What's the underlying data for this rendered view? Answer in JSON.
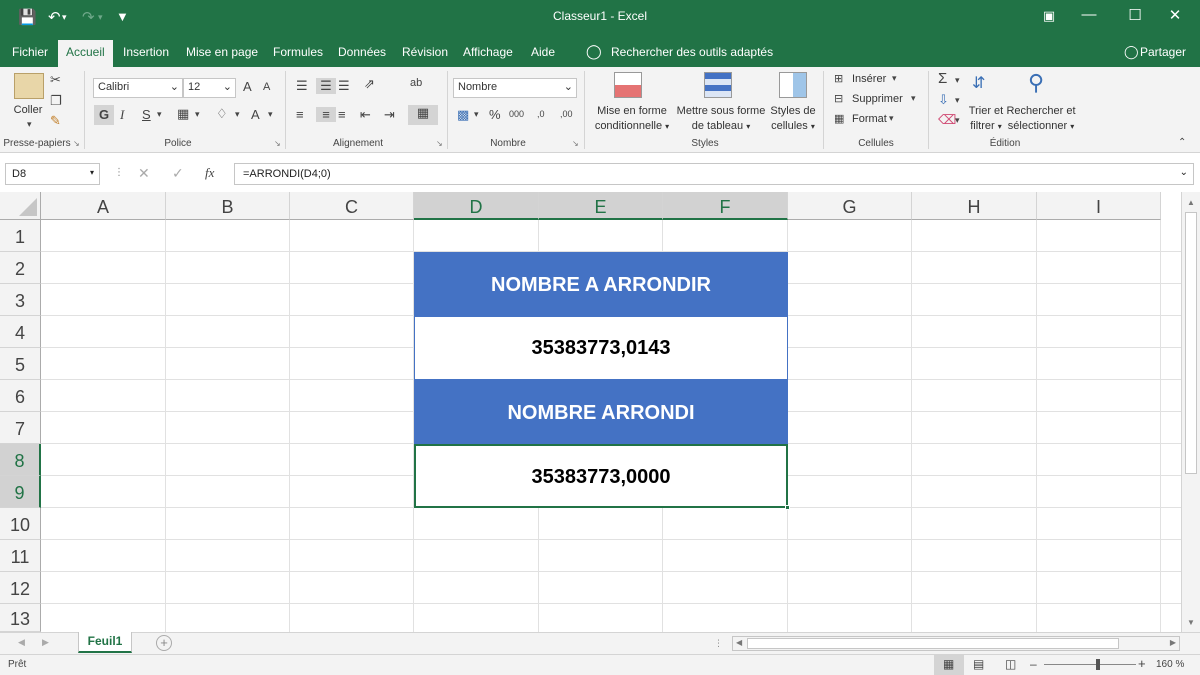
{
  "window": {
    "title": "Classeur1  -  Excel",
    "share_label": "Partager"
  },
  "menu": {
    "tabs": [
      "Fichier",
      "Accueil",
      "Insertion",
      "Mise en page",
      "Formules",
      "Données",
      "Révision",
      "Affichage",
      "Aide"
    ],
    "active_tab": "Accueil",
    "search_hint": "Rechercher des outils adaptés"
  },
  "ribbon": {
    "clipboard": {
      "paste": "Coller",
      "label": "Presse-papiers"
    },
    "font": {
      "name": "Calibri",
      "size": "12",
      "bold": "G",
      "italic": "I",
      "underline": "S",
      "grow": "A",
      "shrink": "A",
      "color_letter": "A",
      "label": "Police"
    },
    "alignment": {
      "label": "Alignement",
      "wrap": "ab"
    },
    "number": {
      "format": "Nombre",
      "percent": "%",
      "thousands": "000",
      "inc_dec": ",0",
      "dec_dec": ",00",
      "label": "Nombre"
    },
    "styles": {
      "conditional": "Mise en forme conditionnelle",
      "table": "Mettre sous forme de tableau",
      "cell_styles": "Styles de cellules",
      "label": "Styles"
    },
    "cells": {
      "insert": "Insérer",
      "delete": "Supprimer",
      "format": "Format",
      "label": "Cellules"
    },
    "editing": {
      "sort": "Trier et filtrer",
      "find": "Rechercher et sélectionner",
      "label": "Édition"
    }
  },
  "formula_bar": {
    "name_box": "D8",
    "formula": "=ARRONDI(D4;0)",
    "fx": "fx"
  },
  "sheet": {
    "columns": [
      "A",
      "B",
      "C",
      "D",
      "E",
      "F",
      "G",
      "H",
      "I"
    ],
    "selected_columns": [
      "D",
      "E",
      "F"
    ],
    "rows": [
      "1",
      "2",
      "3",
      "4",
      "5",
      "6",
      "7",
      "8",
      "9",
      "10",
      "11",
      "12",
      "13"
    ],
    "selected_rows": [
      "8",
      "9"
    ],
    "cells": {
      "header1": "NOMBRE A ARRONDIR",
      "value1": "35383773,0143",
      "header2": "NOMBRE ARRONDI",
      "value2": "35383773,0000"
    },
    "colors": {
      "header_fill": "#4472c4",
      "selection": "#217346"
    }
  },
  "sheet_tabs": {
    "active": "Feuil1",
    "add_symbol": "+"
  },
  "status": {
    "ready": "Prêt",
    "zoom": "160 %"
  }
}
